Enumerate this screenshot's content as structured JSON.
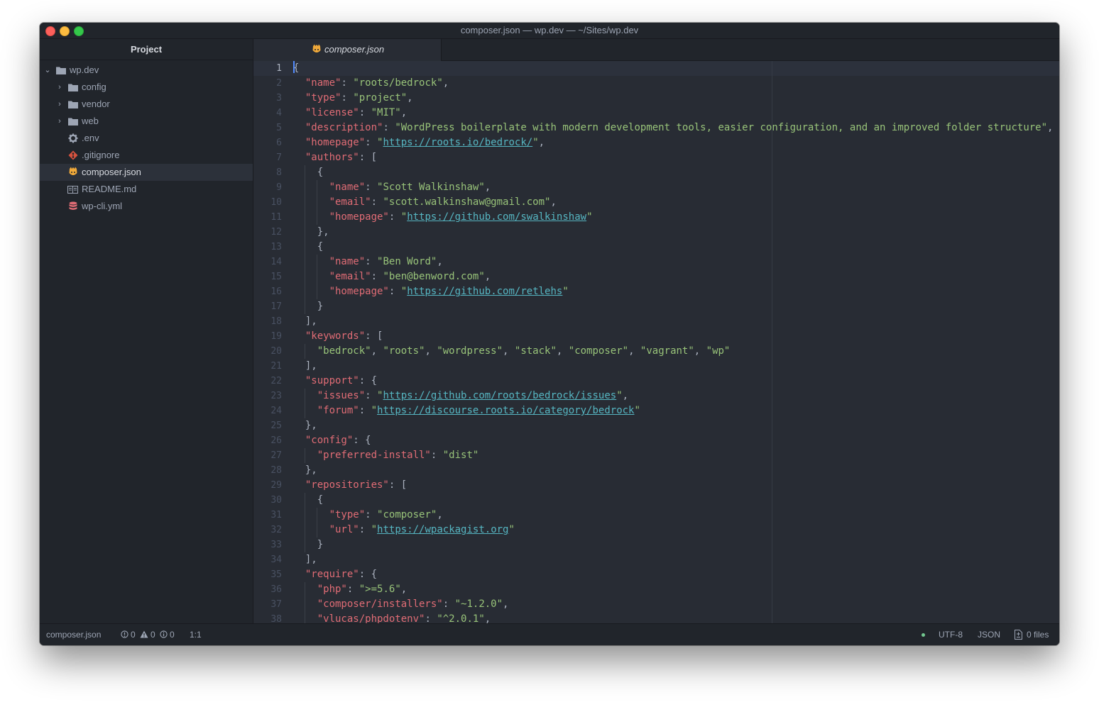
{
  "window": {
    "title": "composer.json — wp.dev — ~/Sites/wp.dev"
  },
  "sidebar": {
    "header": "Project",
    "root": {
      "label": "wp.dev",
      "icon": "folder-icon",
      "expanded": true
    },
    "items": [
      {
        "label": "config",
        "type": "folder",
        "icon": "folder-icon"
      },
      {
        "label": "vendor",
        "type": "folder",
        "icon": "folder-icon"
      },
      {
        "label": "web",
        "type": "folder",
        "icon": "folder-icon"
      },
      {
        "label": ".env",
        "type": "file",
        "icon": "gear-icon"
      },
      {
        "label": ".gitignore",
        "type": "file",
        "icon": "git-icon"
      },
      {
        "label": "composer.json",
        "type": "file",
        "icon": "composer-icon",
        "selected": true
      },
      {
        "label": "README.md",
        "type": "file",
        "icon": "book-icon"
      },
      {
        "label": "wp-cli.yml",
        "type": "file",
        "icon": "database-icon"
      }
    ]
  },
  "tabs": [
    {
      "label": "composer.json",
      "active": true
    }
  ],
  "editor": {
    "line_numbers": [
      "1",
      "2",
      "3",
      "4",
      "5",
      "6",
      "7",
      "8",
      "9",
      "10",
      "11",
      "12",
      "13",
      "14",
      "15",
      "16",
      "17",
      "18",
      "19",
      "20",
      "21",
      "22",
      "23",
      "24",
      "25",
      "26",
      "27",
      "28",
      "29",
      "30",
      "31",
      "32",
      "33",
      "34",
      "35",
      "36",
      "37",
      "38"
    ],
    "lines": [
      "{",
      "  \"name\": \"roots/bedrock\",",
      "  \"type\": \"project\",",
      "  \"license\": \"MIT\",",
      "  \"description\": \"WordPress boilerplate with modern development tools, easier configuration, and an improved folder structure\",",
      "  \"homepage\": \"https://roots.io/bedrock/\",",
      "  \"authors\": [",
      "    {",
      "      \"name\": \"Scott Walkinshaw\",",
      "      \"email\": \"scott.walkinshaw@gmail.com\",",
      "      \"homepage\": \"https://github.com/swalkinshaw\"",
      "    },",
      "    {",
      "      \"name\": \"Ben Word\",",
      "      \"email\": \"ben@benword.com\",",
      "      \"homepage\": \"https://github.com/retlehs\"",
      "    }",
      "  ],",
      "  \"keywords\": [",
      "    \"bedrock\", \"roots\", \"wordpress\", \"stack\", \"composer\", \"vagrant\", \"wp\"",
      "  ],",
      "  \"support\": {",
      "    \"issues\": \"https://github.com/roots/bedrock/issues\",",
      "    \"forum\": \"https://discourse.roots.io/category/bedrock\"",
      "  },",
      "  \"config\": {",
      "    \"preferred-install\": \"dist\"",
      "  },",
      "  \"repositories\": [",
      "    {",
      "      \"type\": \"composer\",",
      "      \"url\": \"https://wpackagist.org\"",
      "    }",
      "  ],",
      "  \"require\": {",
      "    \"php\": \">=5.6\",",
      "    \"composer/installers\": \"~1.2.0\",",
      "    \"vlucas/phpdotenv\": \"^2.0.1\","
    ],
    "cursor_line": 1
  },
  "status": {
    "file": "composer.json",
    "errors": "0",
    "warnings": "0",
    "infos": "0",
    "position": "1:1",
    "encoding": "UTF-8",
    "grammar": "JSON",
    "git_files": "0 files"
  },
  "colors": {
    "key": "#e06c75",
    "string": "#98c379",
    "url": "#56b6c2",
    "punctuation": "#abb2bf",
    "status_dot": "#73c990"
  }
}
